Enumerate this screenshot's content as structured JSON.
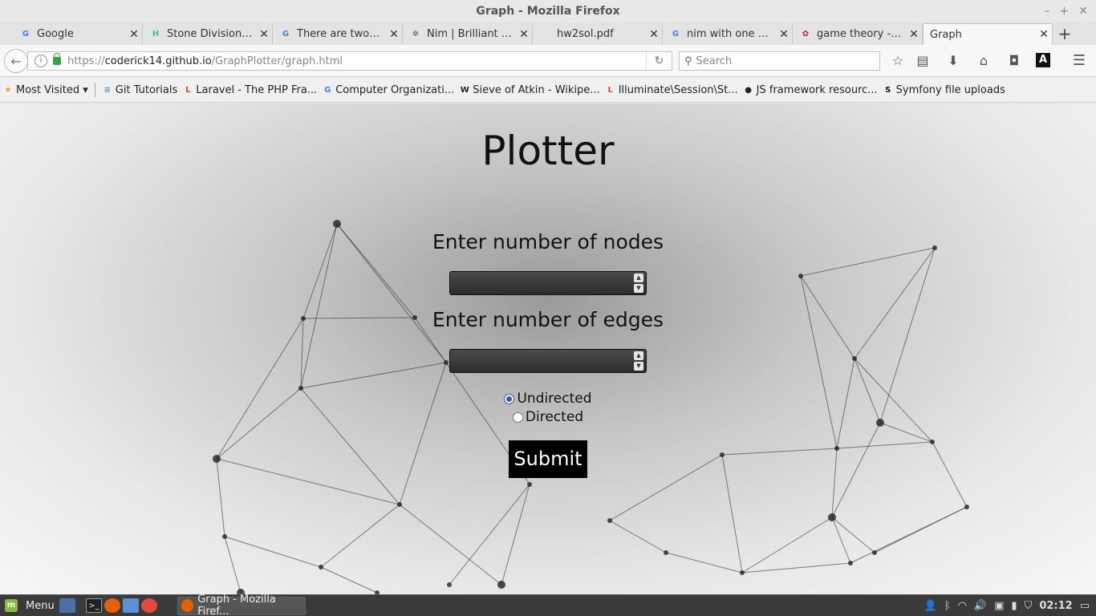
{
  "window": {
    "title": "Graph - Mozilla Firefox",
    "controls": [
      "–",
      "+",
      "✕"
    ]
  },
  "tabs": [
    {
      "label": "Google",
      "icon": "google-icon",
      "color": "#4285f4",
      "glyph": "G",
      "active": false
    },
    {
      "label": "Stone Division | ...",
      "icon": "hackerrank-icon",
      "color": "#2ec866",
      "glyph": "H",
      "active": false
    },
    {
      "label": "There are two pl...",
      "icon": "google-icon",
      "color": "#4285f4",
      "glyph": "G",
      "active": false
    },
    {
      "label": "Nim | Brilliant M...",
      "icon": "brilliant-icon",
      "color": "#555555",
      "glyph": "✲",
      "active": false
    },
    {
      "label": "hw2sol.pdf",
      "icon": "pdf-icon",
      "color": "#f7f7f7",
      "glyph": "",
      "active": false
    },
    {
      "label": "nim with one pile...",
      "icon": "google-icon",
      "color": "#4285f4",
      "glyph": "G",
      "active": false
    },
    {
      "label": "game theory - V...",
      "icon": "mathoverflow-icon",
      "color": "#c0262d",
      "glyph": "✿",
      "active": false
    },
    {
      "label": "Graph",
      "icon": "",
      "color": "",
      "glyph": "",
      "active": true
    }
  ],
  "tab_close": "✕",
  "newtab": "+",
  "nav": {
    "url_prefix": "https://",
    "url_host": "coderick14.github.io",
    "url_path": "/GraphPlotter/graph.html",
    "search_placeholder": "Search"
  },
  "bookmarks": [
    {
      "label": "Most Visited ▾",
      "icon": "most-visited-icon",
      "color": "#e69b2c",
      "glyph": "★"
    },
    {
      "label": "Git Tutorials",
      "icon": "database-icon",
      "color": "#5a86b0",
      "glyph": "≡"
    },
    {
      "label": "Laravel - The PHP Fra...",
      "icon": "laravel-icon",
      "color": "#e74430",
      "glyph": "L"
    },
    {
      "label": "Computer Organizati...",
      "icon": "google-icon",
      "color": "#4285f4",
      "glyph": "G"
    },
    {
      "label": "Sieve of Atkin - Wikipe...",
      "icon": "wikipedia-icon",
      "color": "#222222",
      "glyph": "W"
    },
    {
      "label": "Illuminate\\Session\\St...",
      "icon": "laravel-icon",
      "color": "#e74430",
      "glyph": "L"
    },
    {
      "label": "JS framework resourc...",
      "icon": "github-icon",
      "color": "#222222",
      "glyph": "●"
    },
    {
      "label": "Symfony file uploads",
      "icon": "symfony-icon",
      "color": "#111111",
      "glyph": "S"
    }
  ],
  "page": {
    "title": "Plotter",
    "nodes_label": "Enter number of nodes",
    "nodes_value": "",
    "edges_label": "Enter number of edges",
    "edges_value": "",
    "radio_undirected": "Undirected",
    "radio_directed": "Directed",
    "submit": "Submit"
  },
  "taskbar": {
    "menu": "Menu",
    "task": "Graph - Mozilla Firef...",
    "clock": "02:12"
  }
}
